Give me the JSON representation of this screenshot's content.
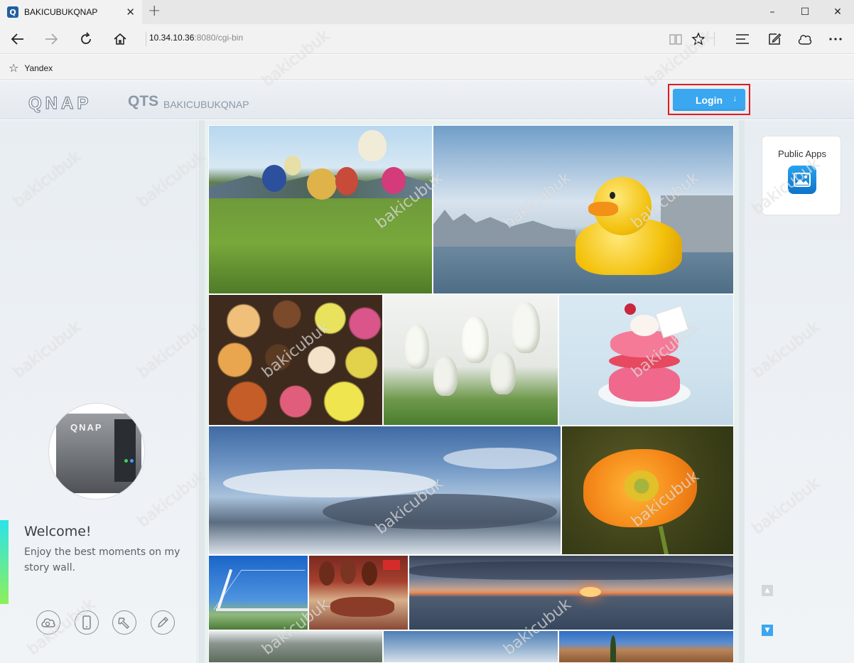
{
  "browser": {
    "tab_title": "BAKICUBUKQNAP",
    "tab_favicon": "Q",
    "new_tab_icon": "+",
    "window_controls": {
      "minimize": "–",
      "maximize": "☐",
      "close": "✕"
    },
    "address": {
      "host": "10.34.10.36",
      "port_path": ":8080/cgi-bin"
    },
    "favorites": [
      {
        "label": "Yandex"
      }
    ]
  },
  "header": {
    "logo": "QNAP",
    "product": "QTS",
    "hostname": "BAKICUBUKQNAP",
    "login_label": "Login",
    "login_arrow": "↓",
    "accent_color": "#3aa7f0",
    "highlight_color": "#e11b1b"
  },
  "left_panel": {
    "device_label": "QNAP",
    "welcome_title": "Welcome!",
    "welcome_text": "Enjoy the best moments on my story wall.",
    "buttons": [
      "cloud-icon",
      "mobile-icon",
      "tools-icon",
      "pencil-icon"
    ]
  },
  "right_panel": {
    "apps_title": "Public Apps",
    "apps_icon": "photo-gallery-icon"
  },
  "photos": [
    "hot-air-balloons",
    "rubber-duck-harbor",
    "macarons",
    "white-tulips",
    "raspberry-macaron",
    "blue-sky-clouds",
    "orange-poppy",
    "suspension-bridge",
    "market-hams",
    "sunset-sea",
    "snowy-trees",
    "sky-partial",
    "palace"
  ],
  "watermark": "bakicubuk"
}
